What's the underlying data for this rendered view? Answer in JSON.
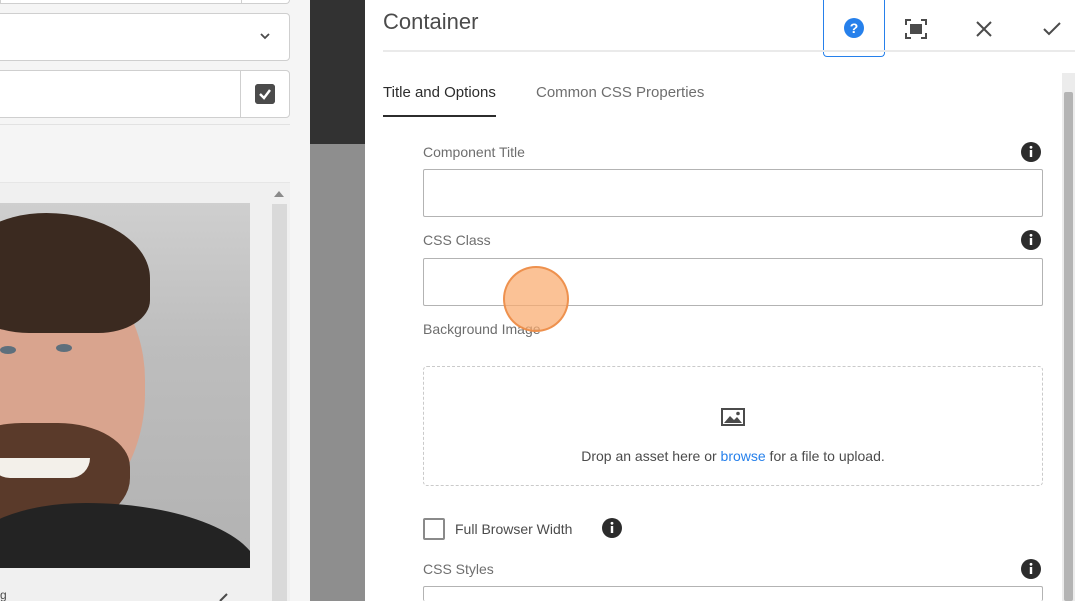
{
  "dialog": {
    "title": "Container",
    "header_buttons": {
      "help": "help-icon",
      "fullscreen": "fullscreen-icon",
      "close": "close-icon",
      "done": "checkmark-icon"
    },
    "tabs": [
      {
        "label": "Title and Options",
        "active": true
      },
      {
        "label": "Common CSS Properties",
        "active": false
      }
    ],
    "fields": {
      "component_title": {
        "label": "Component Title",
        "value": ""
      },
      "css_class": {
        "label": "CSS Class",
        "value": ""
      },
      "background_image": {
        "label": "Background Image",
        "drop_text_before": "Drop an asset here or ",
        "drop_link": "browse",
        "drop_text_after": " for a file to upload."
      },
      "full_browser_width": {
        "label": "Full Browser Width",
        "checked": false
      },
      "css_styles": {
        "label": "CSS Styles"
      }
    }
  },
  "left_panel": {
    "caption": "g"
  },
  "colors": {
    "accent": "#2680eb",
    "text": "#4b4b4b",
    "muted": "#6e6e6e",
    "click_indicator": "#f5a96a"
  }
}
